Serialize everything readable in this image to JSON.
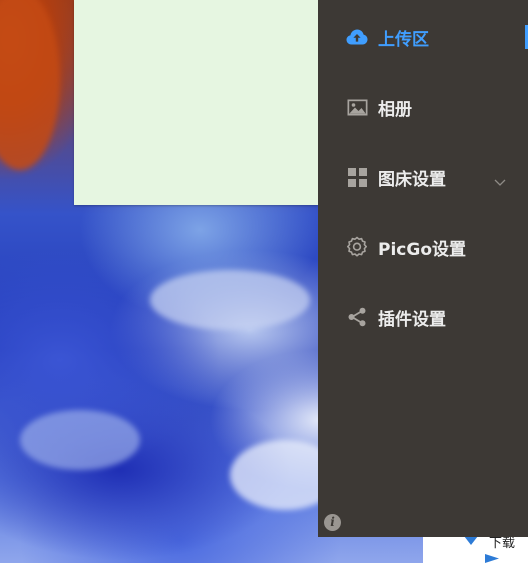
{
  "sidebar": {
    "items": [
      {
        "label": "上传区",
        "icon": "cloud-upload-icon",
        "active": true
      },
      {
        "label": "相册",
        "icon": "image-icon",
        "active": false
      },
      {
        "label": "图床设置",
        "icon": "grid-icon",
        "active": false,
        "has_submenu": true
      },
      {
        "label": "PicGo设置",
        "icon": "gear-icon",
        "active": false
      },
      {
        "label": "插件设置",
        "icon": "share-icon",
        "active": false
      }
    ],
    "info_glyph": "i"
  },
  "explorer_peek": {
    "item_label": "下载"
  },
  "colors": {
    "sidebar_bg": "#3d3935",
    "accent": "#409eff",
    "text": "#ececec",
    "icon": "#a8a49f",
    "panel_bg": "#e6f6e1"
  }
}
